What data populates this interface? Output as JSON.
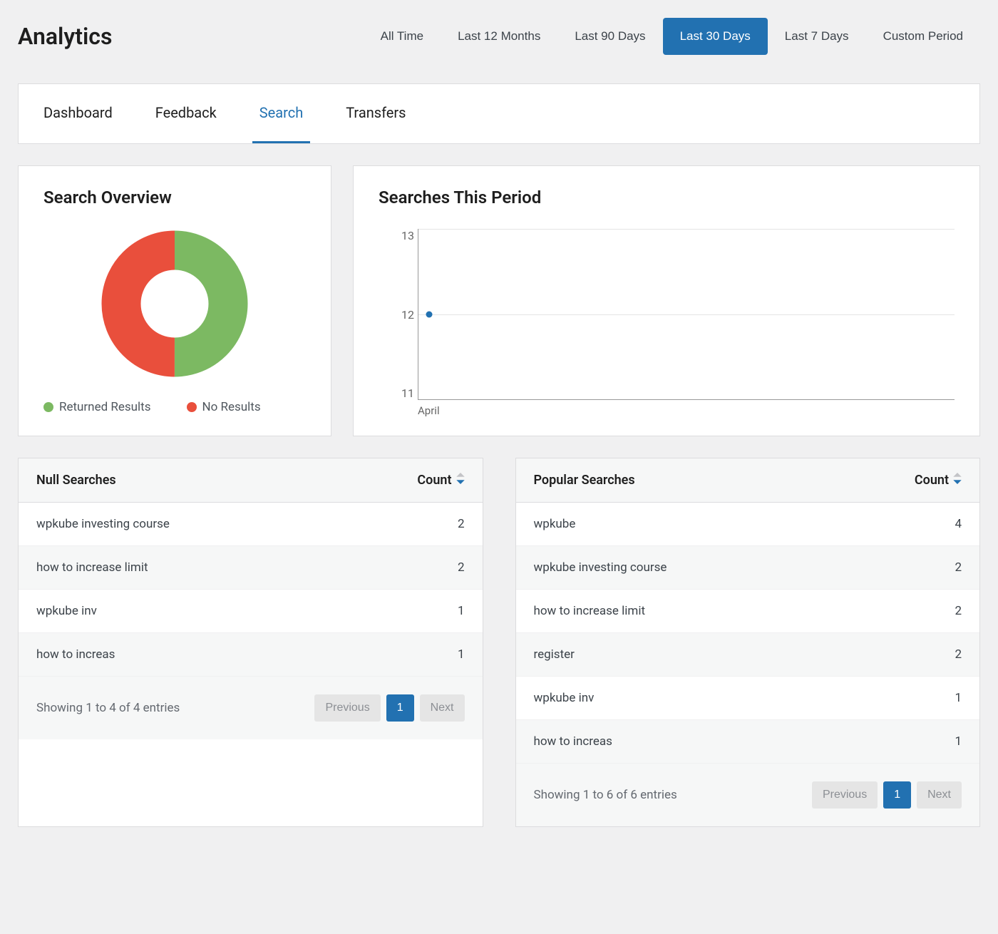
{
  "page_title": "Analytics",
  "periods": [
    {
      "label": "All Time",
      "active": false
    },
    {
      "label": "Last 12 Months",
      "active": false
    },
    {
      "label": "Last 90 Days",
      "active": false
    },
    {
      "label": "Last 30 Days",
      "active": true
    },
    {
      "label": "Last 7 Days",
      "active": false
    },
    {
      "label": "Custom Period",
      "active": false
    }
  ],
  "tabs": [
    {
      "label": "Dashboard",
      "active": false
    },
    {
      "label": "Feedback",
      "active": false
    },
    {
      "label": "Search",
      "active": true
    },
    {
      "label": "Transfers",
      "active": false
    }
  ],
  "overview": {
    "title": "Search Overview",
    "legend": [
      {
        "label": "Returned Results",
        "color": "#7cb962"
      },
      {
        "label": "No Results",
        "color": "#e94f3c"
      }
    ]
  },
  "line": {
    "title": "Searches This Period",
    "y_ticks": [
      "13",
      "12",
      "11"
    ],
    "x_label": "April"
  },
  "null_searches": {
    "title": "Null Searches",
    "count_label": "Count",
    "rows": [
      {
        "term": "wpkube investing course",
        "count": "2"
      },
      {
        "term": "how to increase limit",
        "count": "2"
      },
      {
        "term": "wpkube inv",
        "count": "1"
      },
      {
        "term": "how to increas",
        "count": "1"
      }
    ],
    "entries_text": "Showing 1 to 4 of 4 entries",
    "prev": "Previous",
    "page": "1",
    "next": "Next"
  },
  "popular_searches": {
    "title": "Popular Searches",
    "count_label": "Count",
    "rows": [
      {
        "term": "wpkube",
        "count": "4"
      },
      {
        "term": "wpkube investing course",
        "count": "2"
      },
      {
        "term": "how to increase limit",
        "count": "2"
      },
      {
        "term": "register",
        "count": "2"
      },
      {
        "term": "wpkube inv",
        "count": "1"
      },
      {
        "term": "how to increas",
        "count": "1"
      }
    ],
    "entries_text": "Showing 1 to 6 of 6 entries",
    "prev": "Previous",
    "page": "1",
    "next": "Next"
  },
  "chart_data": [
    {
      "type": "pie",
      "title": "Search Overview",
      "series": [
        {
          "name": "Returned Results",
          "value": 50,
          "color": "#7cb962"
        },
        {
          "name": "No Results",
          "value": 50,
          "color": "#e94f3c"
        }
      ]
    },
    {
      "type": "line",
      "title": "Searches This Period",
      "x": [
        "April"
      ],
      "series": [
        {
          "name": "Searches",
          "values": [
            12
          ]
        }
      ],
      "ylim": [
        11,
        13
      ],
      "ylabel": "",
      "xlabel": ""
    }
  ]
}
